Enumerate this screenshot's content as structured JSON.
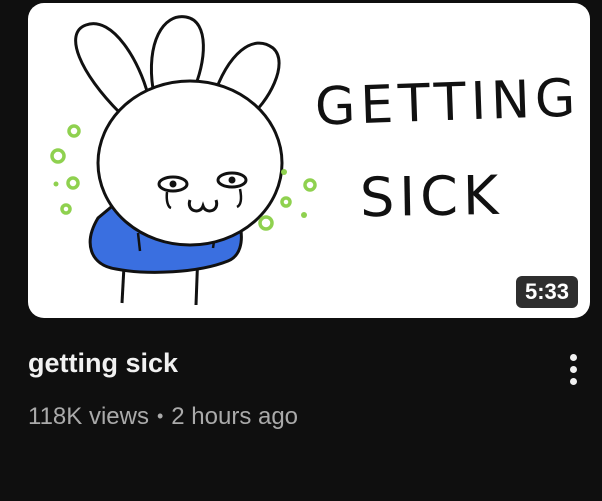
{
  "thumbnail": {
    "text_line1": "GETTING",
    "text_line2": "SICK",
    "duration": "5:33"
  },
  "video": {
    "title": "getting sick",
    "views": "118K views",
    "separator": "•",
    "age": "2 hours ago"
  },
  "icons": {
    "menu": "more-vert-icon"
  },
  "colors": {
    "background": "#0f0f0f",
    "shirt": "#3a6fe0",
    "germs": "#8fd14f"
  }
}
